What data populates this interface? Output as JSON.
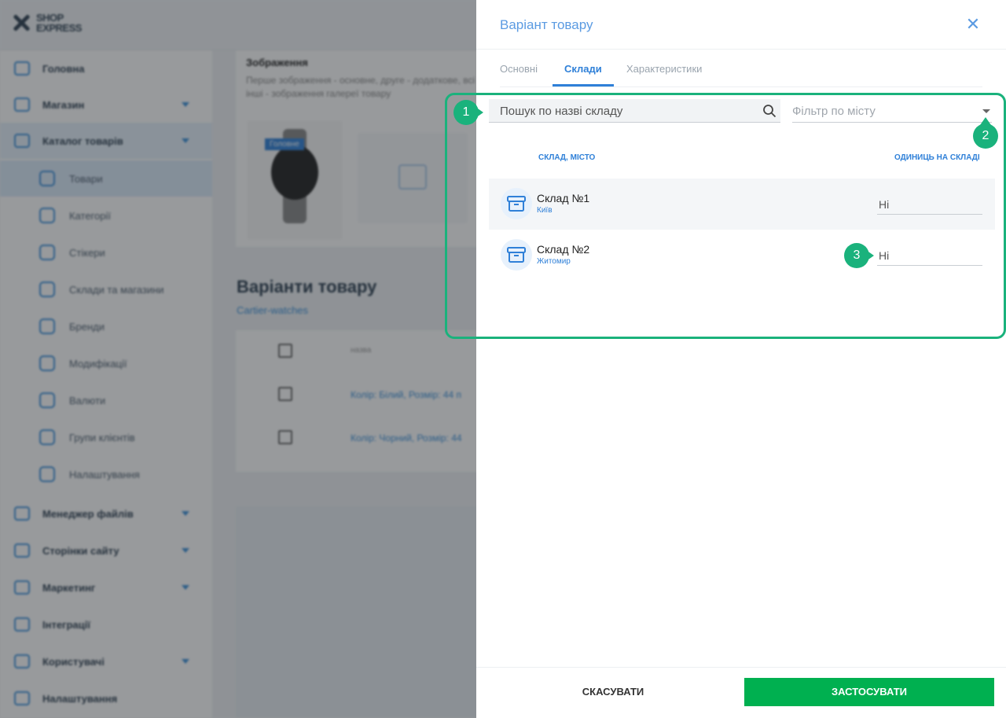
{
  "app": {
    "logo_line1": "SHOP",
    "logo_line2": "EXPRESS"
  },
  "sidebar": {
    "items": [
      {
        "label": "Головна",
        "icon": "home-icon"
      },
      {
        "label": "Магазин",
        "icon": "cart-icon"
      },
      {
        "label": "Каталог товарів",
        "icon": "book-icon"
      },
      {
        "label": "Менеджер файлів",
        "icon": "folder-icon"
      },
      {
        "label": "Сторінки сайту",
        "icon": "page-icon"
      },
      {
        "label": "Маркетинг",
        "icon": "marketing-icon"
      },
      {
        "label": "Інтеграції",
        "icon": "megaphone-icon"
      },
      {
        "label": "Користувачі",
        "icon": "users-icon"
      },
      {
        "label": "Налаштування",
        "icon": "gear-icon"
      }
    ],
    "catalog_sub": [
      {
        "label": "Товари",
        "icon": "box-icon"
      },
      {
        "label": "Категорії",
        "icon": "categories-icon"
      },
      {
        "label": "Стікери",
        "icon": "sticker-icon"
      },
      {
        "label": "Склади та магазини",
        "icon": "warehouse-icon"
      },
      {
        "label": "Бренди",
        "icon": "tag-icon"
      },
      {
        "label": "Модифікації",
        "icon": "bookmark-icon"
      },
      {
        "label": "Валюти",
        "icon": "currency-icon"
      },
      {
        "label": "Групи клієнтів",
        "icon": "user-group-icon"
      },
      {
        "label": "Налаштування",
        "icon": "gear-icon"
      }
    ]
  },
  "main": {
    "images_title": "Зображення",
    "images_desc": "Перше зображення - основне, друге - додаткове, всі інші - зображення галереї товару",
    "main_badge": "Головне",
    "variants_title": "Варіанти товару",
    "variants_sub": "Cartier-watches",
    "table_header": "назва",
    "rows": [
      "Колір: Білий, Розмір: 44 п",
      "Колір: Чорний, Розмір: 44"
    ]
  },
  "drawer": {
    "title": "Варіант товару",
    "close_symbol": "✕",
    "tabs": [
      "Основні",
      "Склади",
      "Характеристики"
    ],
    "active_tab": 1,
    "search": {
      "placeholder": "Пошук по назві складу",
      "value": ""
    },
    "city_filter": {
      "placeholder": "Фільтр по місту"
    },
    "columns": {
      "warehouse": "СКЛАД, МІСТО",
      "units": "ОДИНИЦЬ НА СКЛАДІ"
    },
    "warehouses": [
      {
        "name": "Склад №1",
        "city": "Київ",
        "units": "Ні"
      },
      {
        "name": "Склад №2",
        "city": "Житомир",
        "units": "Ні"
      }
    ],
    "cancel_label": "СКАСУВАТИ",
    "apply_label": "ЗАСТОСУВАТИ"
  },
  "annotations": {
    "callouts": [
      "1",
      "2",
      "3"
    ]
  },
  "colors": {
    "accent": "#2f80d8",
    "apply": "#00b050",
    "annotation": "#1ab27c"
  }
}
